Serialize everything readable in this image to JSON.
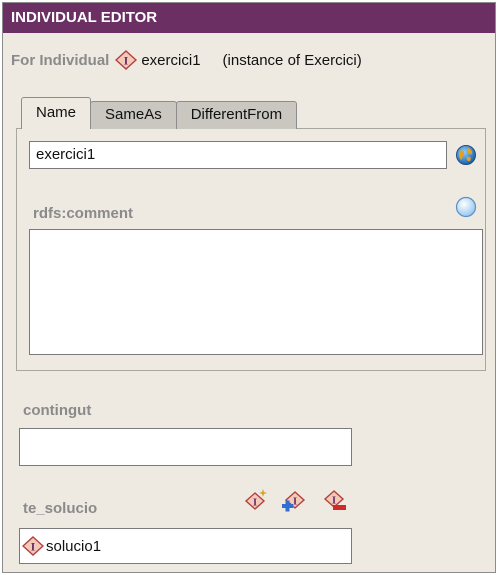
{
  "title": "INDIVIDUAL EDITOR",
  "for_row": {
    "label": "For Individual",
    "individual": "exercici1",
    "instance_text": "(instance of Exercici)"
  },
  "tabs": [
    {
      "label": "Name",
      "active": true
    },
    {
      "label": "SameAs",
      "active": false
    },
    {
      "label": "DifferentFrom",
      "active": false
    }
  ],
  "name_field": {
    "value": "exercici1"
  },
  "comment": {
    "label": "rdfs:comment",
    "value": ""
  },
  "contingut": {
    "label": "contingut",
    "value": ""
  },
  "te_solucio": {
    "label": "te_solucio",
    "items": [
      {
        "label": "solucio1"
      }
    ]
  },
  "icons": {
    "individual": "individual-diamond-icon",
    "language": "globe-icon",
    "comment": "comment-bubble-icon",
    "create": "create-individual-icon",
    "add": "add-individual-icon",
    "remove": "remove-individual-icon"
  },
  "colors": {
    "title_bar": "#6b2f63",
    "panel_bg": "#eeeae2",
    "label_gray": "#8a8a8a"
  }
}
